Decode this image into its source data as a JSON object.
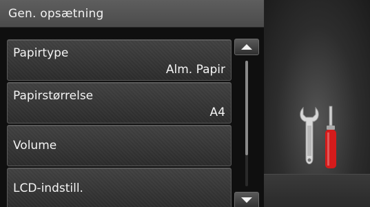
{
  "header": {
    "title": "Gen. opsætning"
  },
  "menu": {
    "items": [
      {
        "label": "Papirtype",
        "value": "Alm. Papir"
      },
      {
        "label": "Papirstørrelse",
        "value": "A4"
      },
      {
        "label": "Volume"
      },
      {
        "label": "LCD-indstill."
      }
    ]
  },
  "scroll": {
    "position_fraction": 0.0,
    "visible_fraction": 0.75
  },
  "icons": {
    "up": "scroll-up-icon",
    "down": "scroll-down-icon",
    "tools": "tools-icon"
  },
  "colors": {
    "screwdriver_handle": "#d51b1b",
    "wrench": "#cfcfcf"
  }
}
